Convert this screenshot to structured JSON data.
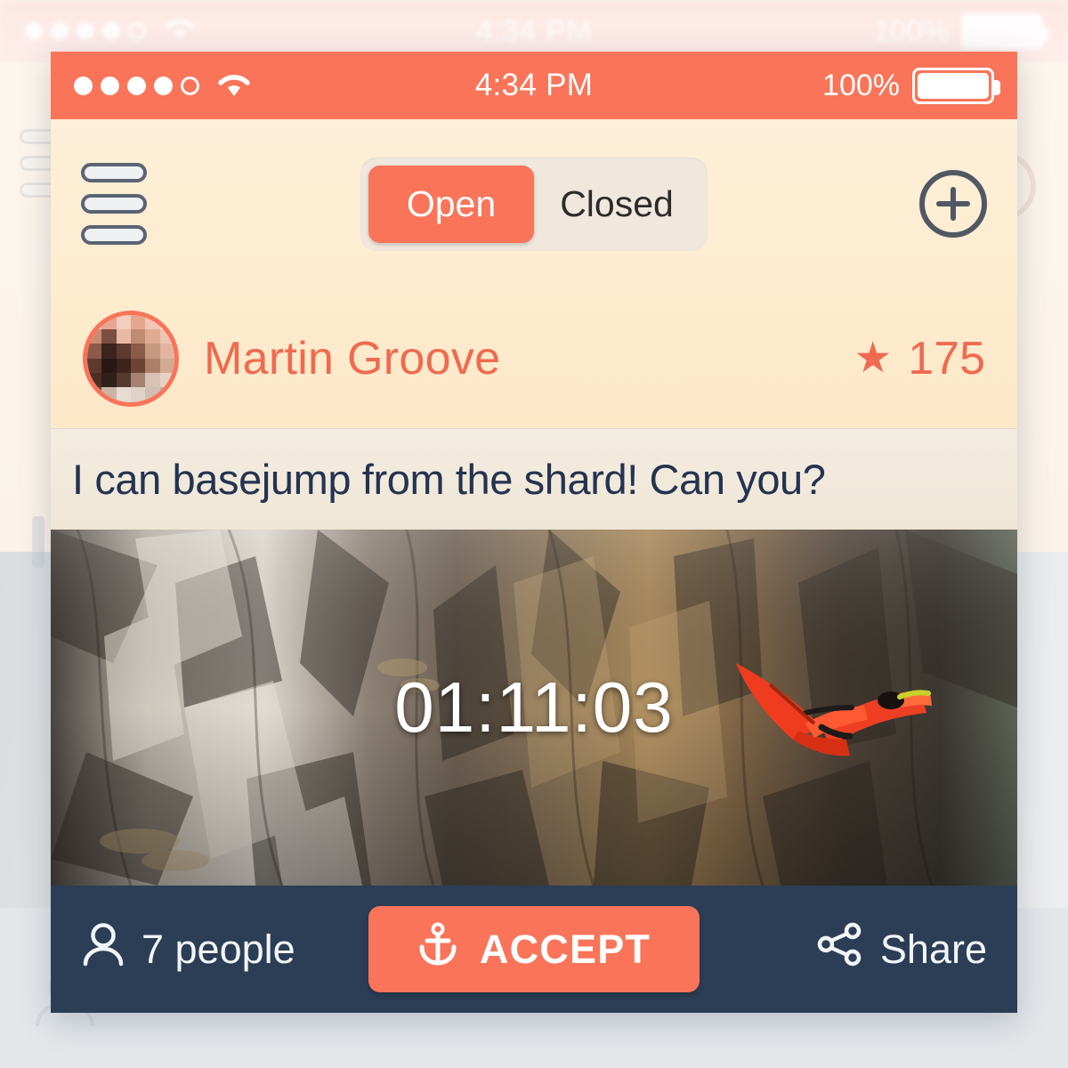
{
  "background": {
    "status_bar": {
      "time": "4:34 PM",
      "battery_percent": "100%",
      "signal_dots": 5,
      "wifi_icon": "wifi-icon"
    }
  },
  "card": {
    "status_bar": {
      "time": "4:34 PM",
      "battery_percent": "100%",
      "signal_dots": 5,
      "wifi_icon": "wifi-icon",
      "battery_icon": "battery-full-icon"
    },
    "toolbar": {
      "menu_icon": "hamburger-menu-icon",
      "add_icon": "plus-circle-icon",
      "segments": [
        {
          "label": "Open",
          "active": true
        },
        {
          "label": "Closed",
          "active": false
        }
      ]
    },
    "user": {
      "name": "Martin Groove",
      "avatar_icon": "user-avatar",
      "star_icon": "★",
      "score": "175"
    },
    "message": {
      "text": "I can basejump from the shard! Can you?"
    },
    "media": {
      "timer": "01:11:03",
      "scene": "cliff-face-wingsuit-basejumper"
    },
    "actions": {
      "people_icon": "person-icon",
      "people_label": "7 people",
      "accept_icon": "anchor-icon",
      "accept_label": "ACCEPT",
      "share_icon": "share-nodes-icon",
      "share_label": "Share"
    }
  },
  "colors": {
    "coral": "#F97459",
    "coral_text": "#EF6A4F",
    "navy": "#2C3E56",
    "cream": "#FDECCF",
    "message_bg": "#F1E9DB",
    "message_text": "#243351"
  }
}
